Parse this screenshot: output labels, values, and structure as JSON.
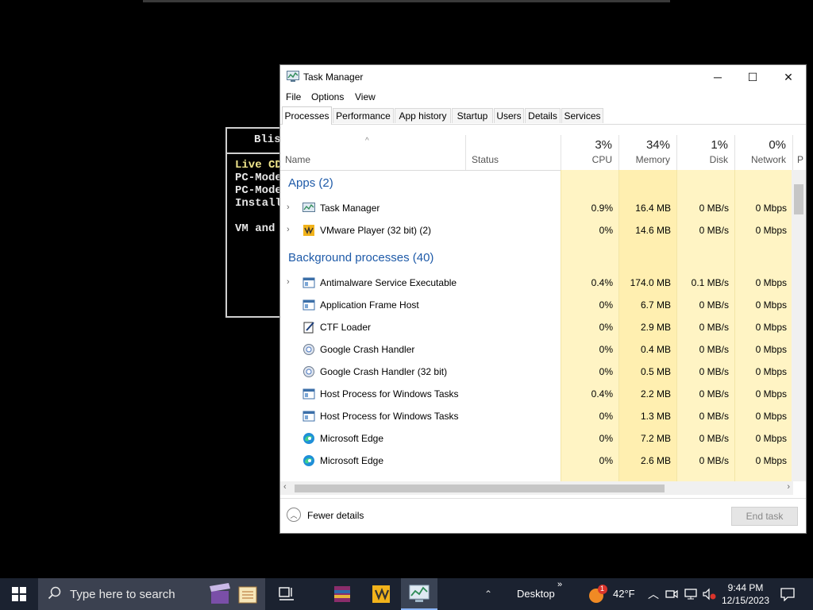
{
  "console": {
    "title": "Blis",
    "lines": [
      "Live CD",
      "PC-Mode",
      "PC-Mode",
      "Install",
      "VM and"
    ]
  },
  "window": {
    "title": "Task Manager",
    "controls": {
      "minimize": "─",
      "maximize": "☐",
      "close": "✕"
    }
  },
  "menu": [
    "File",
    "Options",
    "View"
  ],
  "tabs": [
    "Processes",
    "Performance",
    "App history",
    "Startup",
    "Users",
    "Details",
    "Services"
  ],
  "columns": {
    "name": "Name",
    "status": "Status",
    "cpu": {
      "pct": "3%",
      "label": "CPU"
    },
    "memory": {
      "pct": "34%",
      "label": "Memory"
    },
    "disk": {
      "pct": "1%",
      "label": "Disk"
    },
    "network": {
      "pct": "0%",
      "label": "Network"
    },
    "power": "P"
  },
  "groups": {
    "apps": "Apps (2)",
    "background": "Background processes (40)"
  },
  "apps": [
    {
      "name": "Task Manager",
      "cpu": "0.9%",
      "memory": "16.4 MB",
      "disk": "0 MB/s",
      "network": "0 Mbps",
      "icon": "task-manager-icon"
    },
    {
      "name": "VMware Player (32 bit) (2)",
      "cpu": "0%",
      "memory": "14.6 MB",
      "disk": "0 MB/s",
      "network": "0 Mbps",
      "icon": "vmware-icon"
    }
  ],
  "background": [
    {
      "name": "Antimalware Service Executable",
      "cpu": "0.4%",
      "memory": "174.0 MB",
      "disk": "0.1 MB/s",
      "network": "0 Mbps",
      "icon": "window-icon"
    },
    {
      "name": "Application Frame Host",
      "cpu": "0%",
      "memory": "6.7 MB",
      "disk": "0 MB/s",
      "network": "0 Mbps",
      "icon": "window-icon"
    },
    {
      "name": "CTF Loader",
      "cpu": "0%",
      "memory": "2.9 MB",
      "disk": "0 MB/s",
      "network": "0 Mbps",
      "icon": "ctf-icon"
    },
    {
      "name": "Google Crash Handler",
      "cpu": "0%",
      "memory": "0.4 MB",
      "disk": "0 MB/s",
      "network": "0 Mbps",
      "icon": "google-update-icon"
    },
    {
      "name": "Google Crash Handler (32 bit)",
      "cpu": "0%",
      "memory": "0.5 MB",
      "disk": "0 MB/s",
      "network": "0 Mbps",
      "icon": "google-update-icon"
    },
    {
      "name": "Host Process for Windows Tasks",
      "cpu": "0.4%",
      "memory": "2.2 MB",
      "disk": "0 MB/s",
      "network": "0 Mbps",
      "icon": "window-icon"
    },
    {
      "name": "Host Process for Windows Tasks",
      "cpu": "0%",
      "memory": "1.3 MB",
      "disk": "0 MB/s",
      "network": "0 Mbps",
      "icon": "window-icon"
    },
    {
      "name": "Microsoft Edge",
      "cpu": "0%",
      "memory": "7.2 MB",
      "disk": "0 MB/s",
      "network": "0 Mbps",
      "icon": "edge-icon"
    },
    {
      "name": "Microsoft Edge",
      "cpu": "0%",
      "memory": "2.6 MB",
      "disk": "0 MB/s",
      "network": "0 Mbps",
      "icon": "edge-icon"
    }
  ],
  "footer": {
    "fewer": "Fewer details",
    "end_task": "End task"
  },
  "taskbar": {
    "search_placeholder": "Type here to search",
    "desktop": "Desktop",
    "weather_temp": "42°F",
    "weather_badge": "1",
    "time": "9:44 PM",
    "date": "12/15/2023"
  },
  "colors": {
    "heat_light": "#fff4c4",
    "heat_mid": "#ffefb0",
    "group_blue": "#1e5aa8",
    "taskbar": "#1b2230"
  }
}
